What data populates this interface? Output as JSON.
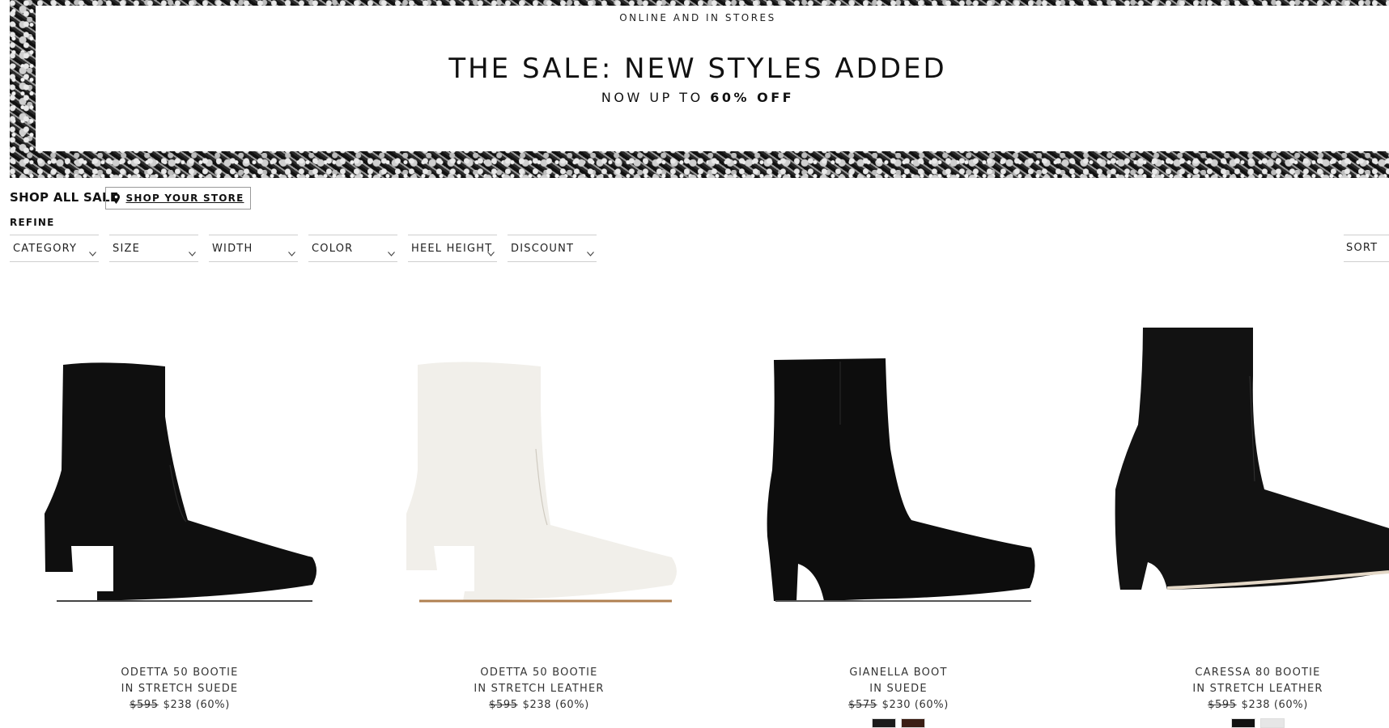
{
  "banner": {
    "eyebrow": "ONLINE AND IN STORES",
    "title": "THE SALE: NEW STYLES ADDED",
    "subtitle_prefix": "NOW UP TO ",
    "subtitle_emphasis": "60% OFF"
  },
  "shop_bar": {
    "shop_all_label": "SHOP ALL SALE",
    "shop_store_label": "SHOP YOUR STORE",
    "store_icon": "map-pin-icon"
  },
  "refine": {
    "label": "REFINE",
    "filters": [
      {
        "label": "CATEGORY"
      },
      {
        "label": "SIZE"
      },
      {
        "label": "WIDTH"
      },
      {
        "label": "COLOR"
      },
      {
        "label": "HEEL HEIGHT"
      },
      {
        "label": "DISCOUNT"
      }
    ],
    "sort_label": "SORT"
  },
  "products": [
    {
      "name": "ODETTA 50 BOOTIE",
      "material": "IN STRETCH SUEDE",
      "original_price": "$595",
      "sale_price": "$238 (60%)",
      "color": "#0f0f0f",
      "swatches": []
    },
    {
      "name": "ODETTA 50 BOOTIE",
      "material": "IN STRETCH LEATHER",
      "original_price": "$595",
      "sale_price": "$238 (60%)",
      "color": "#f1efea",
      "swatches": []
    },
    {
      "name": "GIANELLA BOOT",
      "material": "IN SUEDE",
      "original_price": "$575",
      "sale_price": "$230 (60%)",
      "color": "#0d0d0d",
      "swatches": [
        "#1b1b1b",
        "#3b1e14"
      ]
    },
    {
      "name": "CARESSA 80 BOOTIE",
      "material": "IN STRETCH LEATHER",
      "original_price": "$595",
      "sale_price": "$238 (60%)",
      "color": "#121212",
      "swatches": [
        "#111111",
        "#e6e6e6"
      ]
    }
  ]
}
